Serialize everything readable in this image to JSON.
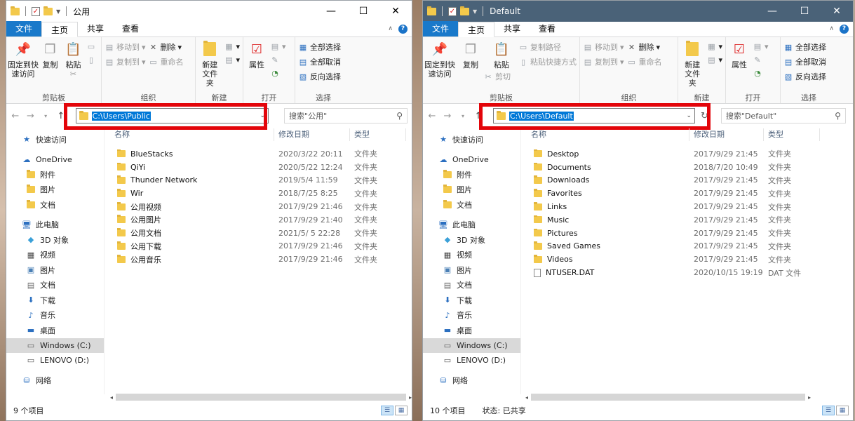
{
  "left": {
    "title": "公用",
    "tabs": [
      "文件",
      "主页",
      "共享",
      "查看"
    ],
    "ribbon": {
      "clipboard": {
        "pin": "固定到快速访问",
        "copy": "复制",
        "paste": "粘贴",
        "copy_path": "",
        "paste_shortcut": "",
        "cut": "",
        "label": "剪贴板"
      },
      "organize": {
        "move_to": "移动到",
        "copy_to": "复制到",
        "delete": "删除",
        "rename": "重命名",
        "label": "组织"
      },
      "new": {
        "new_folder": "新建\n文件夹",
        "label": "新建"
      },
      "open": {
        "properties": "属性",
        "label": "打开"
      },
      "select": {
        "select_all": "全部选择",
        "select_none": "全部取消",
        "invert": "反向选择",
        "label": "选择"
      }
    },
    "address": "C:\\Users\\Public",
    "search_placeholder": "搜索\"公用\"",
    "nav": [
      {
        "icon": "star-icon",
        "label": "快速访问"
      },
      {
        "icon": "cloud-icon",
        "label": "OneDrive"
      },
      {
        "icon": "folder-icon",
        "label": "附件"
      },
      {
        "icon": "folder-icon",
        "label": "图片"
      },
      {
        "icon": "folder-icon",
        "label": "文档"
      },
      {
        "icon": "pc-icon",
        "label": "此电脑"
      },
      {
        "icon": "cube-icon",
        "label": "3D 对象"
      },
      {
        "icon": "film-icon",
        "label": "视频"
      },
      {
        "icon": "picture-icon",
        "label": "图片"
      },
      {
        "icon": "doc-icon",
        "label": "文档"
      },
      {
        "icon": "download-icon",
        "label": "下载"
      },
      {
        "icon": "music-icon",
        "label": "音乐"
      },
      {
        "icon": "desktop-icon",
        "label": "桌面"
      },
      {
        "icon": "drive-icon",
        "label": "Windows (C:)"
      },
      {
        "icon": "drive-icon",
        "label": "LENOVO (D:)"
      },
      {
        "icon": "network-icon",
        "label": "网络"
      }
    ],
    "columns": [
      "名称",
      "修改日期",
      "类型"
    ],
    "files": [
      {
        "name": "BlueStacks",
        "date": "2020/3/22 20:11",
        "type": "文件夹"
      },
      {
        "name": "QiYi",
        "date": "2020/5/22 12:24",
        "type": "文件夹"
      },
      {
        "name": "Thunder Network",
        "date": "2019/5/4 11:59",
        "type": "文件夹"
      },
      {
        "name": "Wir",
        "date": "2018/7/25 8:25",
        "type": "文件夹"
      },
      {
        "name": "公用视频",
        "date": "2017/9/29 21:46",
        "type": "文件夹"
      },
      {
        "name": "公用图片",
        "date": "2017/9/29 21:40",
        "type": "文件夹"
      },
      {
        "name": "公用文档",
        "date": "2021/5/ 5 22:28",
        "type": "文件夹"
      },
      {
        "name": "公用下载",
        "date": "2017/9/29 21:46",
        "type": "文件夹"
      },
      {
        "name": "公用音乐",
        "date": "2017/9/29 21:46",
        "type": "文件夹"
      }
    ],
    "status": "9 个项目"
  },
  "right": {
    "title": "Default",
    "tabs": [
      "文件",
      "主页",
      "共享",
      "查看"
    ],
    "ribbon": {
      "clipboard": {
        "pin": "固定到快速访问",
        "copy": "复制",
        "paste": "粘贴",
        "copy_path": "复制路径",
        "paste_shortcut": "粘贴快捷方式",
        "cut": "剪切",
        "label": "剪贴板"
      },
      "organize": {
        "move_to": "移动到",
        "copy_to": "复制到",
        "delete": "删除",
        "rename": "重命名",
        "label": "组织"
      },
      "new": {
        "new_folder": "新建\n文件夹",
        "label": "新建"
      },
      "open": {
        "properties": "属性",
        "label": "打开"
      },
      "select": {
        "select_all": "全部选择",
        "select_none": "全部取消",
        "invert": "反向选择",
        "label": "选择"
      }
    },
    "address": "C:\\Users\\Default",
    "search_placeholder": "搜索\"Default\"",
    "nav": [
      {
        "icon": "star-icon",
        "label": "快速访问"
      },
      {
        "icon": "cloud-icon",
        "label": "OneDrive"
      },
      {
        "icon": "folder-icon",
        "label": "附件"
      },
      {
        "icon": "folder-icon",
        "label": "图片"
      },
      {
        "icon": "folder-icon",
        "label": "文档"
      },
      {
        "icon": "pc-icon",
        "label": "此电脑"
      },
      {
        "icon": "cube-icon",
        "label": "3D 对象"
      },
      {
        "icon": "film-icon",
        "label": "视频"
      },
      {
        "icon": "picture-icon",
        "label": "图片"
      },
      {
        "icon": "doc-icon",
        "label": "文档"
      },
      {
        "icon": "download-icon",
        "label": "下载"
      },
      {
        "icon": "music-icon",
        "label": "音乐"
      },
      {
        "icon": "desktop-icon",
        "label": "桌面"
      },
      {
        "icon": "drive-icon",
        "label": "Windows (C:)"
      },
      {
        "icon": "drive-icon",
        "label": "LENOVO (D:)"
      },
      {
        "icon": "network-icon",
        "label": "网络"
      }
    ],
    "columns": [
      "名称",
      "修改日期",
      "类型"
    ],
    "files": [
      {
        "name": "Desktop",
        "date": "2017/9/29 21:45",
        "type": "文件夹"
      },
      {
        "name": "Documents",
        "date": "2018/7/20 10:49",
        "type": "文件夹"
      },
      {
        "name": "Downloads",
        "date": "2017/9/29 21:45",
        "type": "文件夹"
      },
      {
        "name": "Favorites",
        "date": "2017/9/29 21:45",
        "type": "文件夹"
      },
      {
        "name": "Links",
        "date": "2017/9/29 21:45",
        "type": "文件夹"
      },
      {
        "name": "Music",
        "date": "2017/9/29 21:45",
        "type": "文件夹"
      },
      {
        "name": "Pictures",
        "date": "2017/9/29 21:45",
        "type": "文件夹"
      },
      {
        "name": "Saved Games",
        "date": "2017/9/29 21:45",
        "type": "文件夹"
      },
      {
        "name": "Videos",
        "date": "2017/9/29 21:45",
        "type": "文件夹"
      },
      {
        "name": "NTUSER.DAT",
        "date": "2020/10/15 19:19",
        "type": "DAT 文件"
      }
    ],
    "status": "10 个项目",
    "status_state": "状态: 已共享"
  },
  "colors": {
    "accent": "#1979ca",
    "highlight_box": "#e3050a",
    "selection": "#0078d7"
  }
}
